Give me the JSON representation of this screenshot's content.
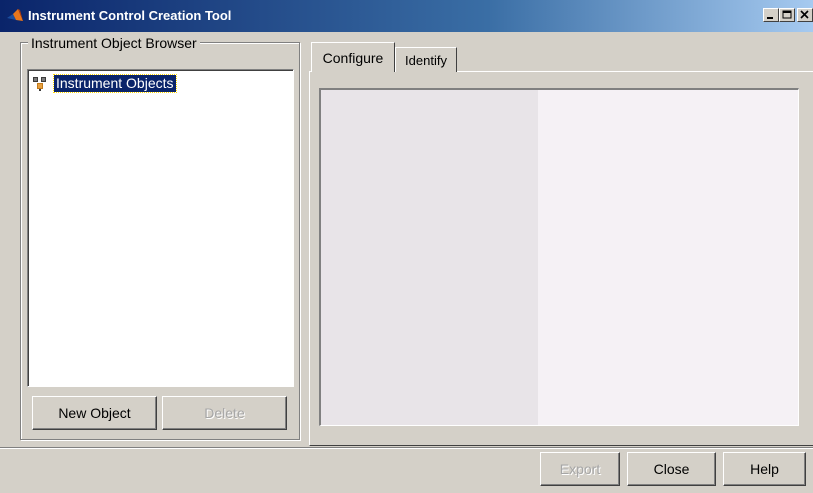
{
  "window": {
    "title": "Instrument Control Creation Tool",
    "controls": [
      "minimize-icon",
      "maximize-icon",
      "close-icon"
    ]
  },
  "browser": {
    "group_label": "Instrument Object Browser",
    "tree": {
      "root_label": "Instrument Objects",
      "root_icon": "instrument-objects-icon",
      "selected": true
    },
    "new_button": "New Object",
    "delete_button": "Delete"
  },
  "tabs": [
    {
      "label": "Configure",
      "active": true
    },
    {
      "label": "Identify",
      "active": false
    }
  ],
  "footer": {
    "export_button": "Export",
    "close_button": "Close",
    "help_button": "Help"
  },
  "colors": {
    "titlebar_start": "#0a246a",
    "titlebar_end": "#a6caf0",
    "selection": "#0a246a",
    "window_bg": "#d4d0c8"
  }
}
